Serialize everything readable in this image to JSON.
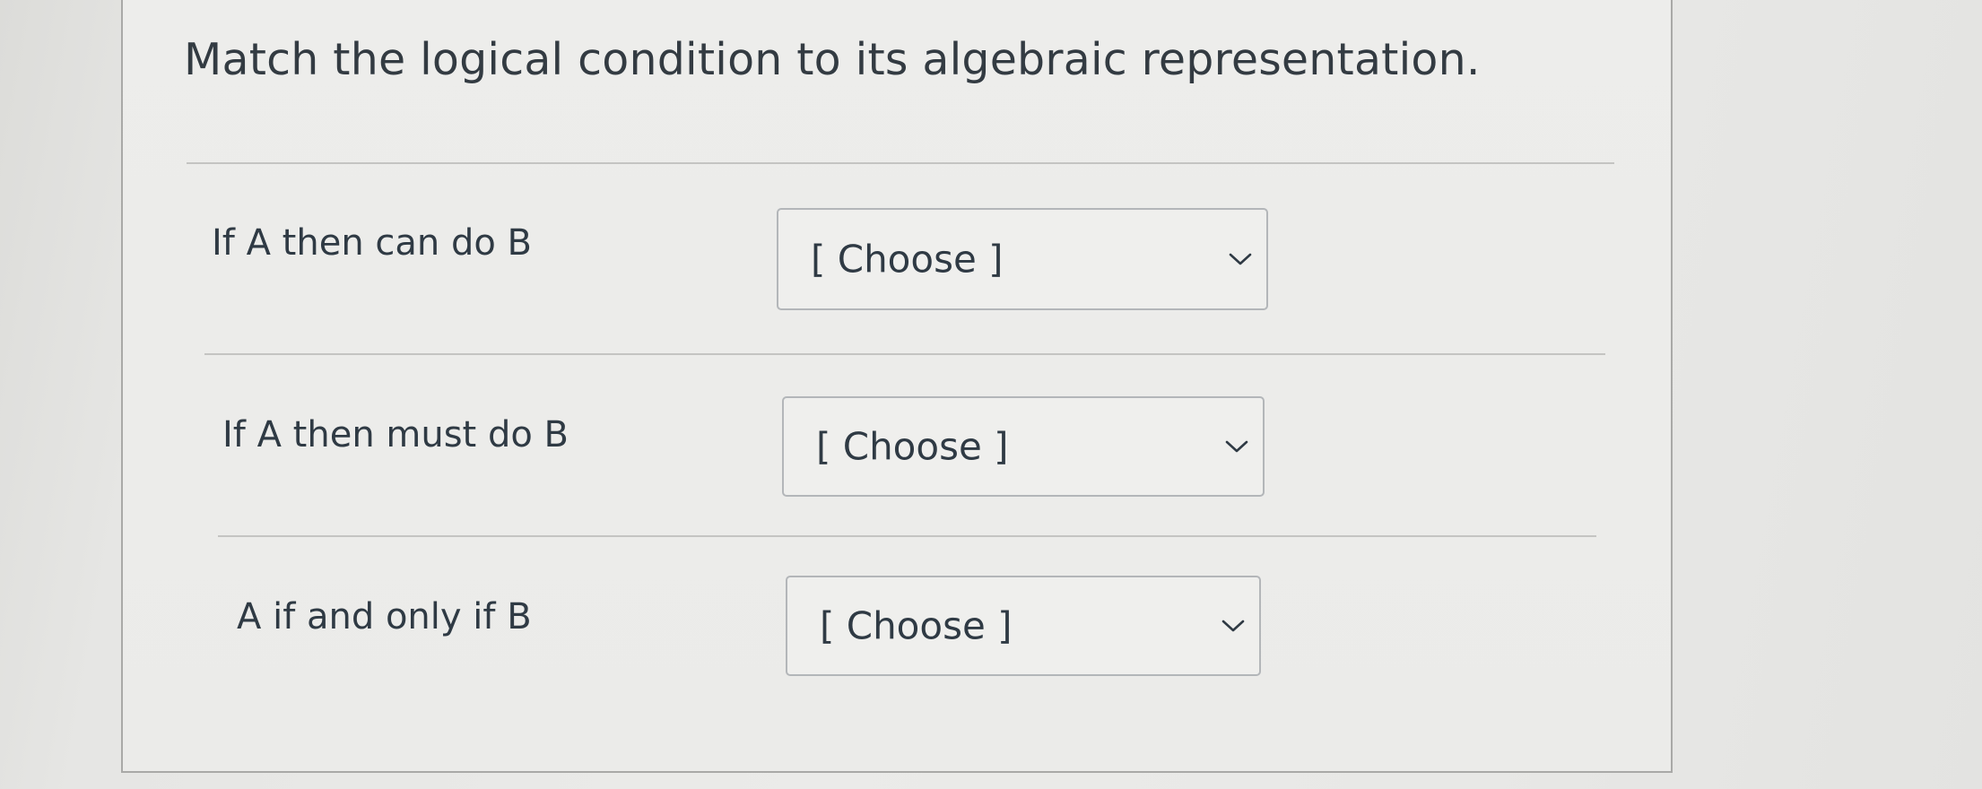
{
  "question": {
    "text": "Match the logical condition to its algebraic representation."
  },
  "matches": [
    {
      "prompt": "If A then can do B",
      "selected": "[ Choose ]",
      "icon": "chevron-down-icon"
    },
    {
      "prompt": "If A then must do B",
      "selected": "[ Choose ]",
      "icon": "chevron-down-icon"
    },
    {
      "prompt": "A if and only if B",
      "selected": "[ Choose ]",
      "icon": "chevron-down-icon"
    }
  ],
  "colors": {
    "text": "#2f3a44",
    "select_border": "#b3b6b9",
    "divider": "#c4c4c2",
    "background": "#ebebe9"
  }
}
